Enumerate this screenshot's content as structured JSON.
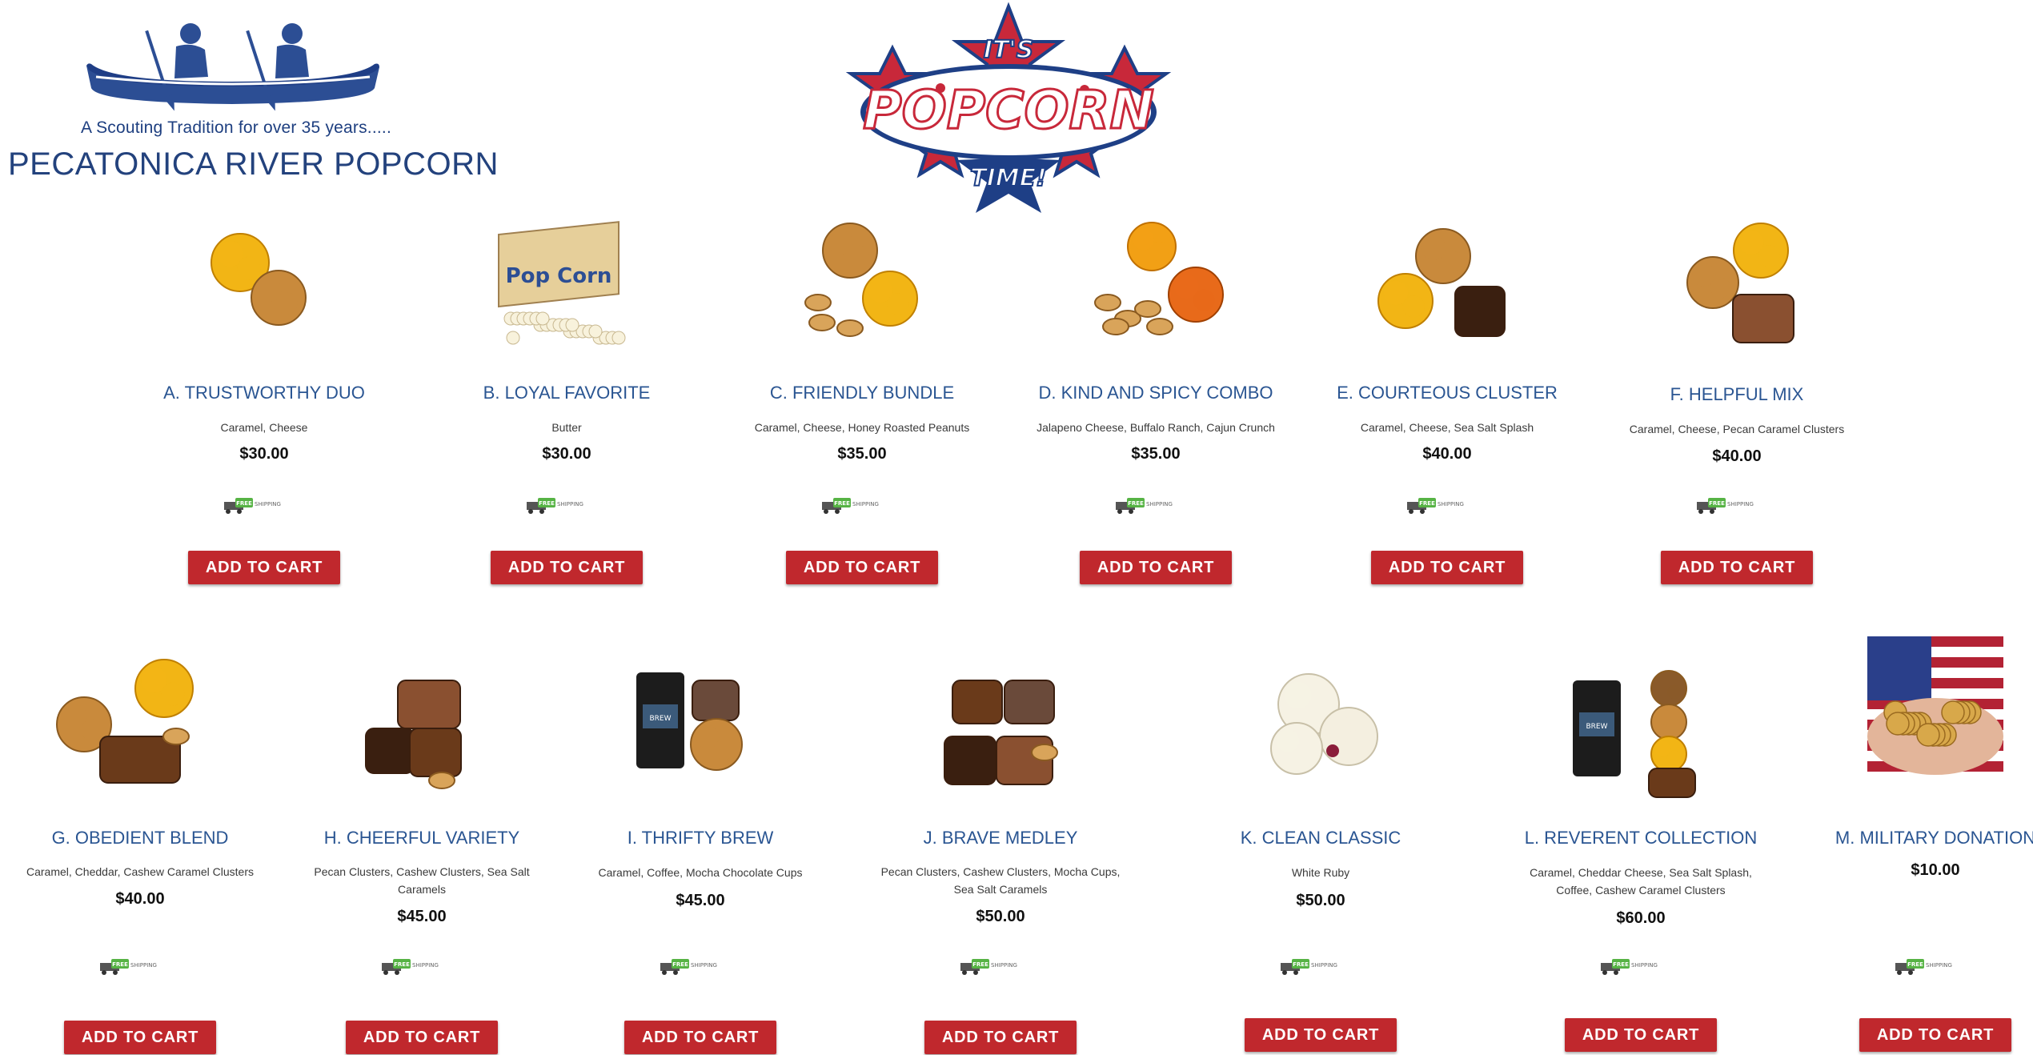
{
  "header": {
    "tagline": "A Scouting Tradition for over 35 years.....",
    "brand": "PECATONICA RIVER POPCORN",
    "badge": {
      "line1": "IT'S",
      "line2": "POPCORN",
      "line3": "TIME!"
    }
  },
  "shipping_badge": {
    "free": "FREE",
    "shipping": "SHIPPING"
  },
  "button_label": "ADD TO CART",
  "colors": {
    "brand_blue": "#23427d",
    "button_red": "#c0282d",
    "name_blue": "#2a5592",
    "ship_green": "#56b344"
  },
  "products": [
    {
      "name": "A. TRUSTWORTHY DUO",
      "desc": "Caramel, Cheese",
      "price": "$30.00",
      "icon": "caramel-cheese-popcorn-image"
    },
    {
      "name": "B. LOYAL FAVORITE",
      "desc": "Butter",
      "price": "$30.00",
      "icon": "butter-popcorn-bags-image"
    },
    {
      "name": "C. FRIENDLY BUNDLE",
      "desc": "Caramel, Cheese, Honey Roasted Peanuts",
      "price": "$35.00",
      "icon": "popcorn-peanuts-image"
    },
    {
      "name": "D. KIND AND SPICY COMBO",
      "desc": "Jalapeno Cheese, Buffalo Ranch, Cajun Crunch",
      "price": "$35.00",
      "icon": "spicy-popcorn-image"
    },
    {
      "name": "E. COURTEOUS CLUSTER",
      "desc": "Caramel, Cheese, Sea Salt Splash",
      "price": "$40.00",
      "icon": "popcorn-chocolate-image"
    },
    {
      "name": "F. HELPFUL MIX",
      "desc": "Caramel, Cheese, Pecan Caramel Clusters",
      "price": "$40.00",
      "icon": "popcorn-pecan-cluster-image"
    },
    {
      "name": "G. OBEDIENT BLEND",
      "desc": "Caramel, Cheddar, Cashew Caramel Clusters",
      "price": "$40.00",
      "icon": "popcorn-cashew-cluster-image"
    },
    {
      "name": "H. CHEERFUL VARIETY",
      "desc": "Pecan Clusters, Cashew Clusters, Sea Salt Caramels",
      "price": "$45.00",
      "icon": "chocolate-clusters-image"
    },
    {
      "name": "I. THRIFTY BREW",
      "desc": "Caramel, Coffee, Mocha Chocolate Cups",
      "price": "$45.00",
      "icon": "coffee-bag-image"
    },
    {
      "name": "J. BRAVE MEDLEY",
      "desc": "Pecan Clusters, Cashew Clusters, Mocha Cups, Sea Salt Caramels",
      "price": "$50.00",
      "icon": "chocolate-medley-image"
    },
    {
      "name": "K. CLEAN CLASSIC",
      "desc": "White Ruby",
      "price": "$50.00",
      "icon": "white-popcorn-image"
    },
    {
      "name": "L. REVERENT COLLECTION",
      "desc": "Caramel, Cheddar Cheese, Sea Salt Splash, Coffee, Cashew Caramel Clusters",
      "price": "$60.00",
      "icon": "coffee-popcorn-stack-image"
    },
    {
      "name": "M. MILITARY DONATION",
      "desc": "",
      "price": "$10.00",
      "icon": "flag-hands-popcorn-image"
    }
  ]
}
